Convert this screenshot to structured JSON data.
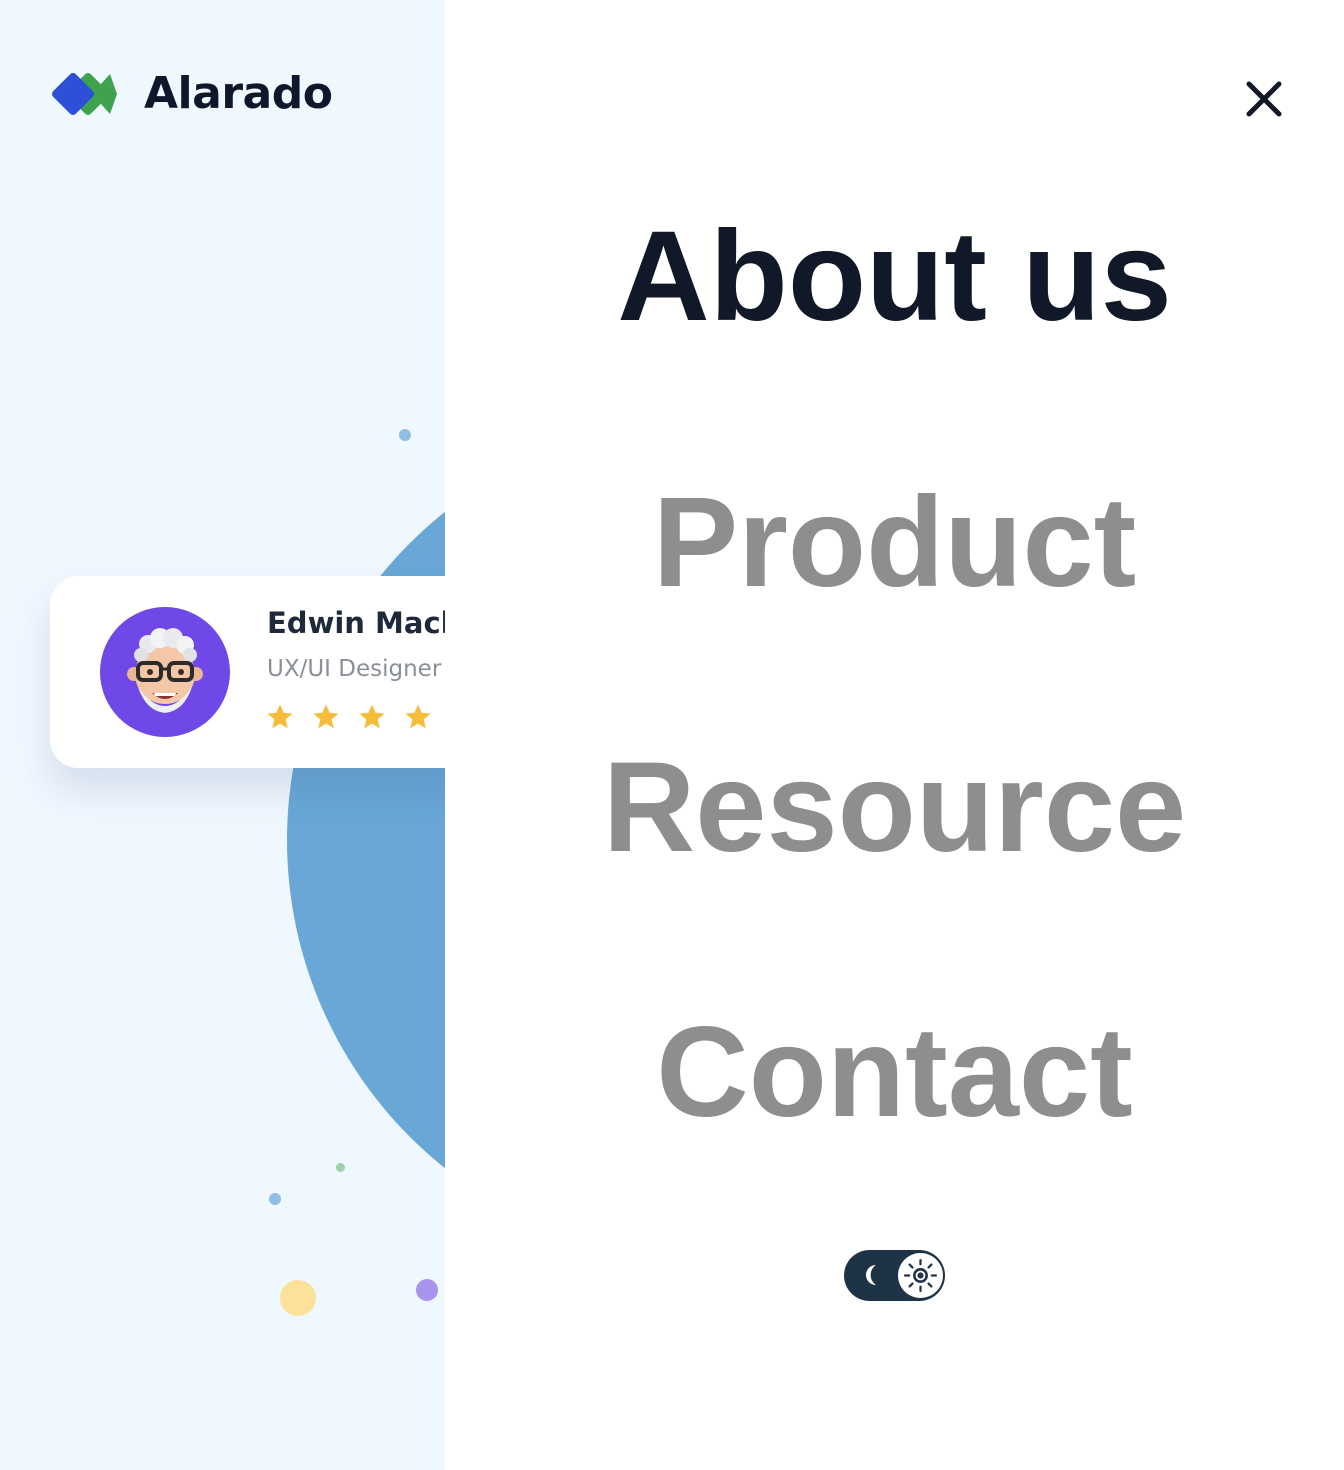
{
  "brand": {
    "name": "Alarado",
    "logo_icon": "alarado-logo-icon",
    "colors": {
      "primary": "#2e4fd8",
      "secondary": "#3fa34d"
    }
  },
  "profile_card": {
    "name": "Edwin Mack",
    "role": "UX/UI Designer",
    "rating": 4,
    "avatar_icon": "memoji-avatar",
    "star_color": "#f6bd3b"
  },
  "menu": {
    "close_icon": "close-icon",
    "items": [
      {
        "label": "About us",
        "active": true
      },
      {
        "label": "Product",
        "active": false
      },
      {
        "label": "Resource",
        "active": false
      },
      {
        "label": "Contact",
        "active": false
      }
    ],
    "active_color": "#111827",
    "inactive_color": "#8e8e90"
  },
  "theme_toggle": {
    "mode": "light",
    "left_icon": "moon-icon",
    "right_icon": "sun-icon",
    "track_color": "#1f3347"
  },
  "hero": {
    "circle_color": "#68a7d6",
    "background": "#eff7ff"
  }
}
